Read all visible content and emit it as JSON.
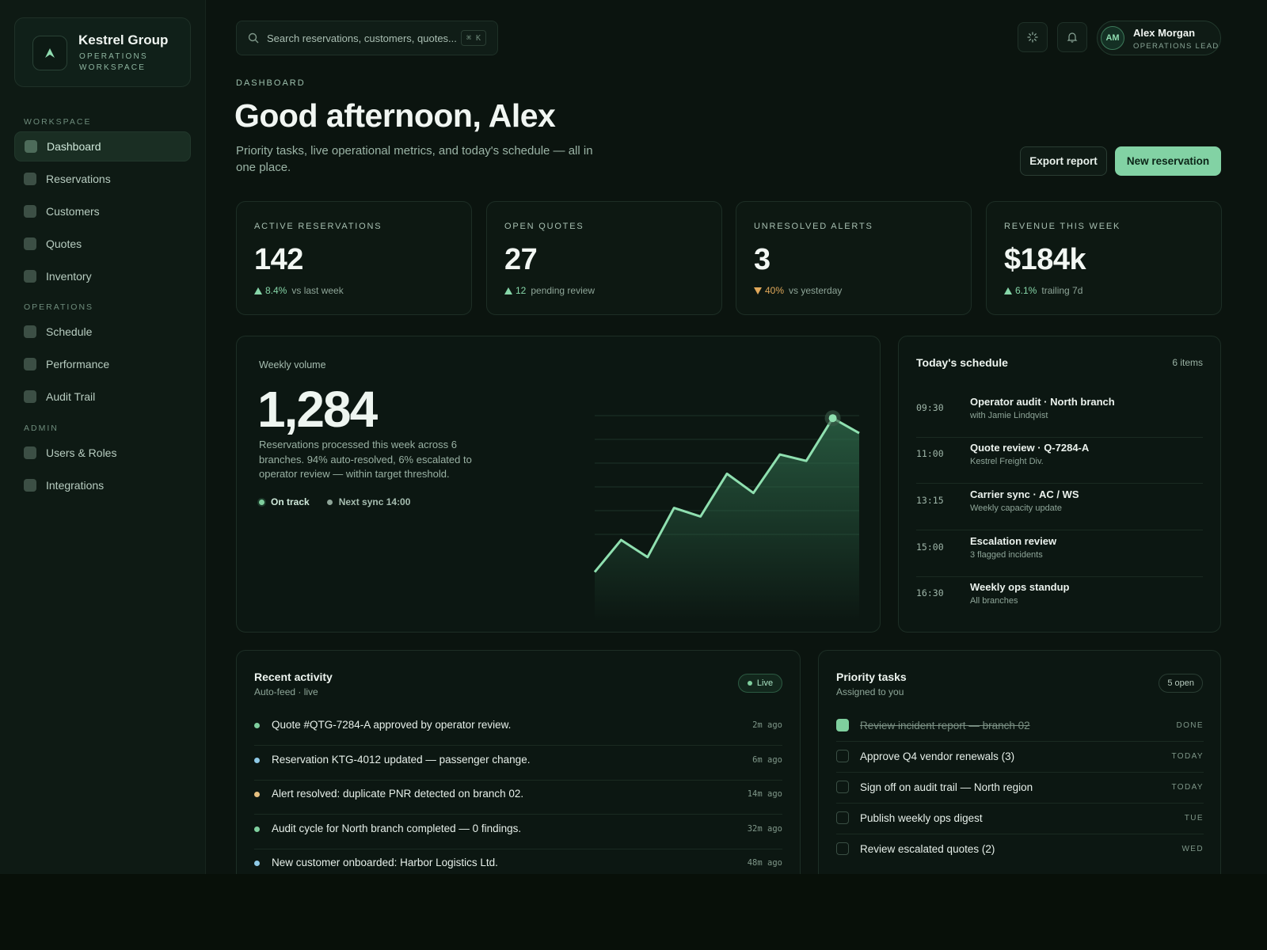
{
  "brand": {
    "name": "Kestrel Group",
    "subtitle": "OPERATIONS WORKSPACE"
  },
  "sidebar": {
    "sections": [
      {
        "title": "WORKSPACE",
        "items": [
          "Dashboard",
          "Reservations",
          "Customers",
          "Quotes",
          "Inventory"
        ]
      },
      {
        "title": "OPERATIONS",
        "items": [
          "Schedule",
          "Performance",
          "Audit Trail"
        ]
      },
      {
        "title": "ADMIN",
        "items": [
          "Users & Roles",
          "Integrations"
        ]
      }
    ],
    "active": "Dashboard"
  },
  "search": {
    "placeholder": "Search reservations, customers, quotes...",
    "shortcut": "⌘ K"
  },
  "user": {
    "initials": "AM",
    "name": "Alex Morgan",
    "role": "OPERATIONS LEAD"
  },
  "header": {
    "eyebrow": "DASHBOARD",
    "greeting": "Good afternoon, Alex",
    "subtitle": "Priority tasks, live operational metrics, and today's schedule — all in one place.",
    "export_label": "Export report",
    "new_label": "New reservation"
  },
  "kpis": [
    {
      "label": "ACTIVE RESERVATIONS",
      "value": "142",
      "direction": "up",
      "delta": "8.4%",
      "note": "vs last week"
    },
    {
      "label": "OPEN QUOTES",
      "value": "27",
      "direction": "up",
      "delta": "12",
      "note": "pending review"
    },
    {
      "label": "UNRESOLVED ALERTS",
      "value": "3",
      "direction": "down",
      "delta": "40%",
      "note": "vs yesterday"
    },
    {
      "label": "REVENUE THIS WEEK",
      "value": "$184k",
      "direction": "up",
      "delta": "6.1%",
      "note": "trailing 7d"
    }
  ],
  "volume": {
    "label": "Weekly volume",
    "value": "1,284",
    "description": "Reservations processed this week across 6 branches. 94% auto-resolved, 6% escalated to operator review — within target threshold.",
    "status_on_track": "On track",
    "status_sync": "Next sync 14:00"
  },
  "chart_data": {
    "type": "area",
    "title": "",
    "xlabel": "",
    "ylabel": "",
    "values": [
      12,
      27,
      19,
      42,
      38,
      58,
      49,
      67,
      64,
      84,
      77
    ],
    "ylim": [
      0,
      100
    ],
    "grid": true,
    "highlight_index": 9,
    "colors": {
      "line": "#8fe0b0",
      "fill": "#2f6b4c"
    }
  },
  "schedule": {
    "title": "Today's schedule",
    "count": "6 items",
    "items": [
      {
        "time": "09:30",
        "title": "Operator audit · North branch",
        "sub": "with Jamie Lindqvist"
      },
      {
        "time": "11:00",
        "title": "Quote review · Q-7284-A",
        "sub": "Kestrel Freight Div."
      },
      {
        "time": "13:15",
        "title": "Carrier sync · AC / WS",
        "sub": "Weekly capacity update"
      },
      {
        "time": "15:00",
        "title": "Escalation review",
        "sub": "3 flagged incidents"
      },
      {
        "time": "16:30",
        "title": "Weekly ops standup",
        "sub": "All branches"
      }
    ]
  },
  "activity": {
    "title": "Recent activity",
    "subtitle": "Auto-feed · live",
    "live": "Live",
    "items": [
      {
        "text": "Quote #QTG-7284-A approved by operator review.",
        "time": "2m ago",
        "color": "#7fcf9e"
      },
      {
        "text": "Reservation KTG-4012 updated — passenger change.",
        "time": "6m ago",
        "color": "#8ec9e6"
      },
      {
        "text": "Alert resolved: duplicate PNR detected on branch 02.",
        "time": "14m ago",
        "color": "#e6c080"
      },
      {
        "text": "Audit cycle for North branch completed — 0 findings.",
        "time": "32m ago",
        "color": "#7fcf9e"
      },
      {
        "text": "New customer onboarded: Harbor Logistics Ltd.",
        "time": "48m ago",
        "color": "#8ec9e6"
      }
    ]
  },
  "tasks": {
    "title": "Priority tasks",
    "subtitle": "Assigned to you",
    "count": "5 open",
    "items": [
      {
        "text": "Review incident report — branch 02",
        "due": "DONE",
        "done": true
      },
      {
        "text": "Approve Q4 vendor renewals (3)",
        "due": "TODAY",
        "done": false
      },
      {
        "text": "Sign off on audit trail — North region",
        "due": "TODAY",
        "done": false
      },
      {
        "text": "Publish weekly ops digest",
        "due": "TUE",
        "done": false
      },
      {
        "text": "Review escalated quotes (2)",
        "due": "WED",
        "done": false
      }
    ]
  }
}
